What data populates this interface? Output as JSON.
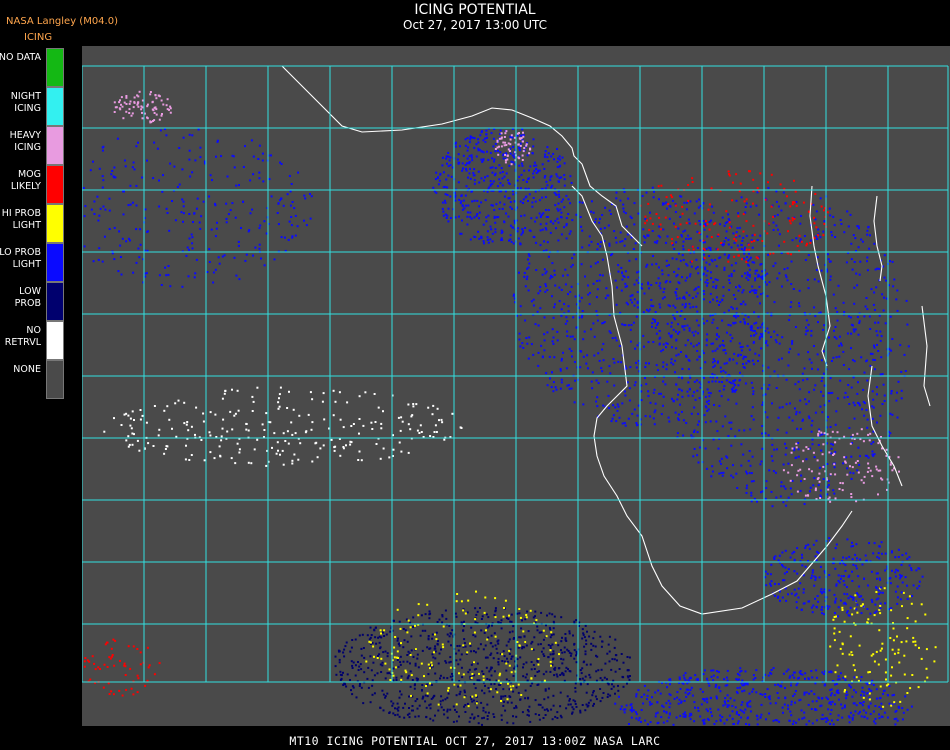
{
  "header": {
    "org": "NASA Langley (M04.0)",
    "product": "ICING",
    "title": "ICING POTENTIAL",
    "subtitle": "Oct 27, 2017 13:00 UTC"
  },
  "legend": [
    {
      "label": "NO DATA",
      "color": "#14b814"
    },
    {
      "label": "NIGHT\nICING",
      "color": "#33f0f0"
    },
    {
      "label": "HEAVY\nICING",
      "color": "#e89be0"
    },
    {
      "label": "MOG\nLIKELY",
      "color": "#ff0000"
    },
    {
      "label": "HI PROB\nLIGHT",
      "color": "#ffff00"
    },
    {
      "label": "LO PROB\nLIGHT",
      "color": "#0a0aff"
    },
    {
      "label": "LOW\nPROB",
      "color": "#00006e"
    },
    {
      "label": "NO\nRETRVL",
      "color": "#ffffff"
    },
    {
      "label": "NONE",
      "color": "#4a4a4a"
    }
  ],
  "map": {
    "background_color": "#4a4a4a",
    "grid_color": "#33e0e0",
    "coast_color": "#ffffff",
    "grid_label_color": "#c01818"
  },
  "footer": {
    "text": "MT10  ICING POTENTIAL   OCT 27, 2017 13:00Z   NASA LARC"
  }
}
